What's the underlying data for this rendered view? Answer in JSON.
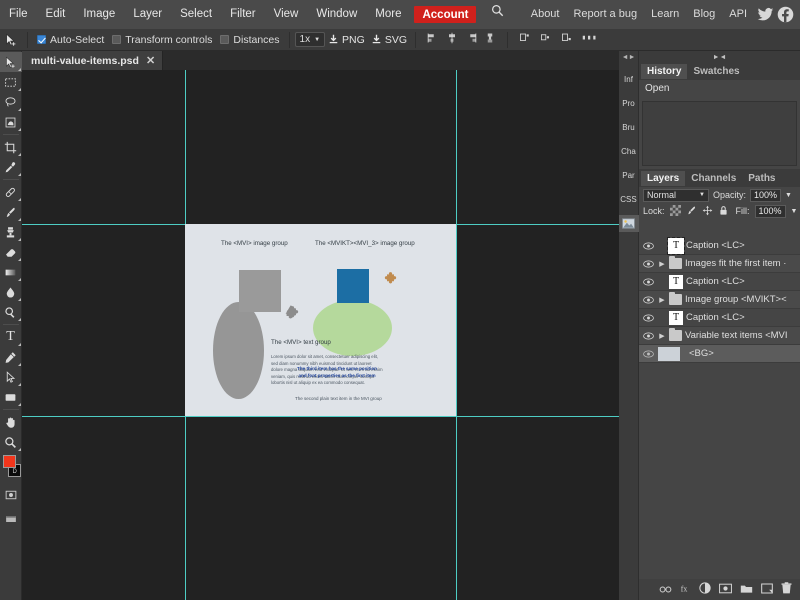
{
  "menubar": {
    "items": [
      "File",
      "Edit",
      "Image",
      "Layer",
      "Select",
      "Filter",
      "View",
      "Window",
      "More"
    ],
    "account_label": "Account",
    "search_icon": "search-icon",
    "right_items": [
      "About",
      "Report a bug",
      "Learn",
      "Blog",
      "API"
    ],
    "twitter_icon": "twitter-icon",
    "facebook_icon": "facebook-icon",
    "accent_color": "#d0211c"
  },
  "optionsbar": {
    "move_tool_icon": "move-tool-icon",
    "auto_select_label": "Auto-Select",
    "auto_select_checked": true,
    "transform_controls_label": "Transform controls",
    "transform_controls_checked": false,
    "distances_label": "Distances",
    "distances_checked": false,
    "zoom_value": "1x",
    "export_png_label": "PNG",
    "export_svg_label": "SVG",
    "align_icons": [
      "align-left-icon",
      "align-center-icon",
      "align-right-icon",
      "align-middle-icon"
    ],
    "distribute_icons": [
      "distribute-left-icon",
      "distribute-center-icon",
      "distribute-right-icon",
      "distribute-horizontal-icon"
    ]
  },
  "toolbar": {
    "tools": [
      {
        "name": "move-tool",
        "glyph": "move",
        "active": true
      },
      {
        "name": "marquee-tool",
        "glyph": "marquee",
        "active": false
      },
      {
        "name": "lasso-tool",
        "glyph": "lasso",
        "active": false
      },
      {
        "name": "magic-wand-tool",
        "glyph": "wand",
        "active": false
      },
      {
        "name": "crop-tool",
        "glyph": "crop",
        "active": false
      },
      {
        "name": "eyedropper-tool",
        "glyph": "eyedropper",
        "active": false
      },
      {
        "name": "healing-brush-tool",
        "glyph": "heal",
        "active": false
      },
      {
        "name": "brush-tool",
        "glyph": "brush",
        "active": false
      },
      {
        "name": "clone-stamp-tool",
        "glyph": "stamp",
        "active": false
      },
      {
        "name": "eraser-tool",
        "glyph": "eraser",
        "active": false
      },
      {
        "name": "gradient-tool",
        "glyph": "gradient",
        "active": false
      },
      {
        "name": "blur-tool",
        "glyph": "blur",
        "active": false
      },
      {
        "name": "dodge-tool",
        "glyph": "dodge",
        "active": false
      },
      {
        "name": "type-tool",
        "glyph": "type",
        "active": false
      },
      {
        "name": "pen-tool",
        "glyph": "pen",
        "active": false
      },
      {
        "name": "path-select-tool",
        "glyph": "pathselect",
        "active": false
      },
      {
        "name": "shape-tool",
        "glyph": "shape",
        "active": false
      },
      {
        "name": "hand-tool",
        "glyph": "hand",
        "active": false
      },
      {
        "name": "zoom-tool",
        "glyph": "zoom",
        "active": false
      }
    ],
    "foreground_color": "#f2361c",
    "background_color": "#0a0a0a",
    "reset_label": "D",
    "quickmask_icon": "quick-mask-icon",
    "screenmode_icon": "screen-mode-icon"
  },
  "document": {
    "tab_title": "multi-value-items.psd",
    "close_icon": "close-icon"
  },
  "canvas": {
    "guides_color": "#4ecdc4",
    "background_color": "#222222",
    "artboard_color": "#dfe3e8",
    "labels": {
      "image_group_left": "The <MVI> image group",
      "image_group_right": "The <MVIKT><MVI_3> image group",
      "text_group": "The <MVI> text group"
    },
    "body_text": "Lorem ipsum dolor sit amet, consectetuer adipiscing elit,\nsed diam nonummy nibh euismod tincidunt ut laoreet\ndolore magna aliquam erat volutpat. Ut wisi enim ad minim\nveniam, quis nostrud exerci tation ullamcorper suscipit\nlobortis nisl ut aliquip ex ea commodo consequat.",
    "blue_text": "The third item has the same position and font properties as the first item",
    "second_text": "The second plain text item in the MVI group",
    "shapes": {
      "gray_square_color": "#9a9a9a",
      "blue_square_color": "#1c6ea4",
      "gray_ellipse_color": "#969696",
      "green_ellipse_color": "#b5d99c",
      "puzzle_gray_color": "#8c8c8c",
      "puzzle_tan_color": "#c08b4e"
    }
  },
  "dock": {
    "rail": {
      "collapse_icon": "collapse-icon",
      "tabs": [
        "Inf",
        "Pro",
        "Bru",
        "Cha",
        "Par",
        "CSS"
      ],
      "image_icon": "image-icon"
    },
    "top_panel": {
      "collapse_icon": "collapse-panel-icon",
      "tabs": [
        {
          "label": "History",
          "selected": true
        },
        {
          "label": "Swatches",
          "selected": false
        }
      ],
      "history_items": [
        "Open"
      ]
    },
    "layers_panel": {
      "tabs": [
        {
          "label": "Layers",
          "selected": true
        },
        {
          "label": "Channels",
          "selected": false
        },
        {
          "label": "Paths",
          "selected": false
        }
      ],
      "blend_mode": "Normal",
      "opacity_label": "Opacity:",
      "opacity_value": "100%",
      "lock_label": "Lock:",
      "lock_icons": [
        "lock-transparency-icon",
        "lock-image-icon",
        "lock-position-icon",
        "lock-all-icon"
      ],
      "fill_label": "Fill:",
      "fill_value": "100%",
      "layers": [
        {
          "name": "Caption <LC>",
          "type": "text",
          "visible": true,
          "expandable": false,
          "selected": false,
          "thumb_selected": true
        },
        {
          "name": "Images fit the first item ·",
          "type": "group",
          "visible": true,
          "expandable": true,
          "selected": false,
          "thumb_selected": false
        },
        {
          "name": "Caption <LC>",
          "type": "text",
          "visible": true,
          "expandable": false,
          "selected": false,
          "thumb_selected": false
        },
        {
          "name": "Image group <MVIKT><",
          "type": "group",
          "visible": true,
          "expandable": true,
          "selected": false,
          "thumb_selected": false
        },
        {
          "name": "Caption <LC>",
          "type": "text",
          "visible": true,
          "expandable": false,
          "selected": false,
          "thumb_selected": false
        },
        {
          "name": "Variable text items <MVI",
          "type": "group",
          "visible": true,
          "expandable": true,
          "selected": false,
          "thumb_selected": false
        },
        {
          "name": "<BG>",
          "type": "background",
          "visible": true,
          "expandable": false,
          "selected": true,
          "thumb_selected": false
        }
      ],
      "footer_icons": [
        "link-layers-icon",
        "layer-style-icon",
        "adjustment-layer-icon",
        "layer-mask-icon",
        "new-group-icon",
        "new-layer-icon",
        "delete-layer-icon"
      ]
    }
  }
}
